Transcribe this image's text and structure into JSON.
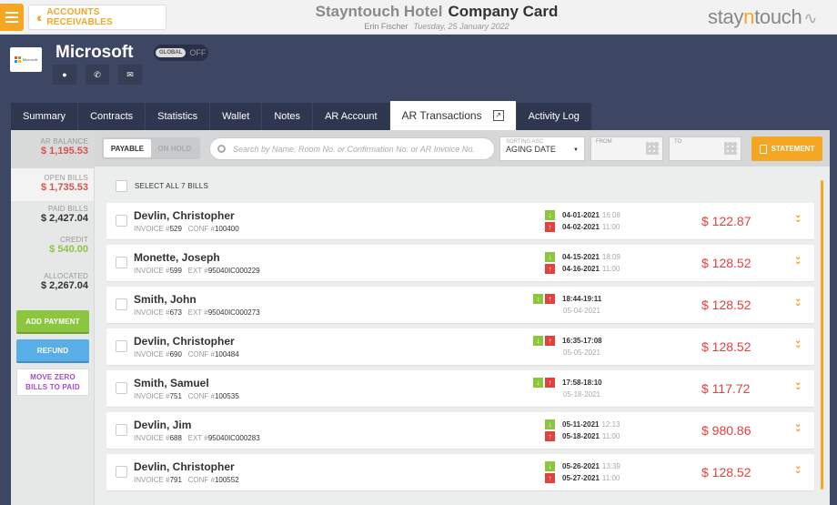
{
  "topbar": {
    "back_label": "ACCOUNTS RECEIVABLES",
    "hotel_name": "Stayntouch Hotel",
    "page_title": "Company Card",
    "user": "Erin Fischer",
    "date": "Tuesday, 25 January 2022",
    "logo_pre": "stay",
    "logo_n": "n",
    "logo_post": "touch"
  },
  "header": {
    "company_name": "Microsoft",
    "logo_text": "Microsoft",
    "global_label": "GLOBAL",
    "global_state": "OFF"
  },
  "tabs": [
    "Summary",
    "Contracts",
    "Statistics",
    "Wallet",
    "Notes",
    "AR Account",
    "AR Transactions",
    "Activity Log"
  ],
  "active_tab": "AR Transactions",
  "sidebar": {
    "ar_balance_label": "AR BALANCE",
    "ar_balance": "$ 1,195.53",
    "open_bills_label": "OPEN BILLS",
    "open_bills": "$ 1,735.53",
    "paid_bills_label": "PAID BILLS",
    "paid_bills": "$ 2,427.04",
    "credit_label": "CREDIT",
    "credit": "$ 540.00",
    "allocated_label": "ALLOCATED",
    "allocated": "$ 2,267.04",
    "add_payment": "ADD PAYMENT",
    "refund": "REFUND",
    "move_zero_1": "MOVE ZERO",
    "move_zero_2": "BILLS TO PAID"
  },
  "filters": {
    "payable": "PAYABLE",
    "on_hold": "ON HOLD",
    "search_placeholder": "Search by Name, Room No. or Confirmation No. or AR Invoice No.",
    "sort_label": "SORTING ASC",
    "sort_value": "AGING DATE",
    "from_label": "FROM",
    "to_label": "TO",
    "statement": "STATEMENT"
  },
  "select_all": "SELECT ALL 7 BILLS",
  "bills": [
    {
      "name": "Devlin, Christopher",
      "invoice": "529",
      "ref_type": "CONF",
      "ref": "100400",
      "date1": "04-01-2021",
      "time1": "16:08",
      "date2": "04-02-2021",
      "time2": "11:00",
      "amount": "$ 122.87",
      "mode": "range"
    },
    {
      "name": "Monette, Joseph",
      "invoice": "599",
      "ref_type": "EXT",
      "ref": "95040IC000229",
      "date1": "04-15-2021",
      "time1": "18:09",
      "date2": "04-16-2021",
      "time2": "11:00",
      "amount": "$ 128.52",
      "mode": "range"
    },
    {
      "name": "Smith, John",
      "invoice": "673",
      "ref_type": "EXT",
      "ref": "95040IC000273",
      "date1": "18:44-19:11",
      "time1": "",
      "date2": "05-04-2021",
      "time2": "",
      "amount": "$ 128.52",
      "mode": "single"
    },
    {
      "name": "Devlin, Christopher",
      "invoice": "690",
      "ref_type": "CONF",
      "ref": "100484",
      "date1": "16:35-17:08",
      "time1": "",
      "date2": "05-05-2021",
      "time2": "",
      "amount": "$ 128.52",
      "mode": "single"
    },
    {
      "name": "Smith, Samuel",
      "invoice": "751",
      "ref_type": "CONF",
      "ref": "100535",
      "date1": "17:58-18:10",
      "time1": "",
      "date2": "05-18-2021",
      "time2": "",
      "amount": "$ 117.72",
      "mode": "single"
    },
    {
      "name": "Devlin, Jim",
      "invoice": "688",
      "ref_type": "EXT",
      "ref": "95040IC000283",
      "date1": "05-11-2021",
      "time1": "12:13",
      "date2": "05-18-2021",
      "time2": "11:00",
      "amount": "$ 980.86",
      "mode": "range"
    },
    {
      "name": "Devlin, Christopher",
      "invoice": "791",
      "ref_type": "CONF",
      "ref": "100552",
      "date1": "05-26-2021",
      "time1": "13:39",
      "date2": "05-27-2021",
      "time2": "11:00",
      "amount": "$ 128.52",
      "mode": "range"
    }
  ],
  "invoice_label": "INVOICE #",
  "colors": {
    "accent": "#f5a623",
    "header": "#3d4663",
    "negative": "#e2413d",
    "positive": "#8cc63f",
    "refund": "#5aaee8"
  }
}
